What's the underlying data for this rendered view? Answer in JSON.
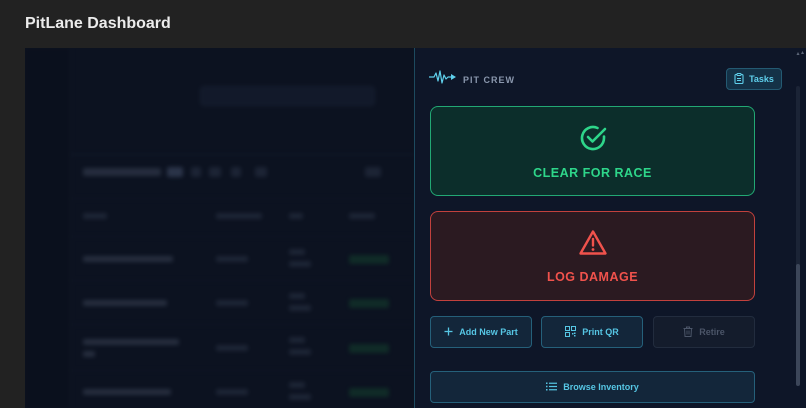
{
  "app": {
    "title": "PitLane Dashboard"
  },
  "panel": {
    "brand": "PIT CREW",
    "tasks_label": "Tasks",
    "clear_label": "CLEAR FOR RACE",
    "damage_label": "LOG DAMAGE",
    "add_part_label": "Add New Part",
    "print_qr_label": "Print QR",
    "retire_label": "Retire",
    "browse_label": "Browse Inventory"
  },
  "colors": {
    "accent": "#56c6e4",
    "success": "#2ed68a",
    "danger": "#f0524c"
  },
  "icons": [
    "heartbeat-icon",
    "clipboard-icon",
    "check-circle-icon",
    "warning-triangle-icon",
    "plus-icon",
    "qr-code-icon",
    "trash-icon",
    "list-icon"
  ]
}
